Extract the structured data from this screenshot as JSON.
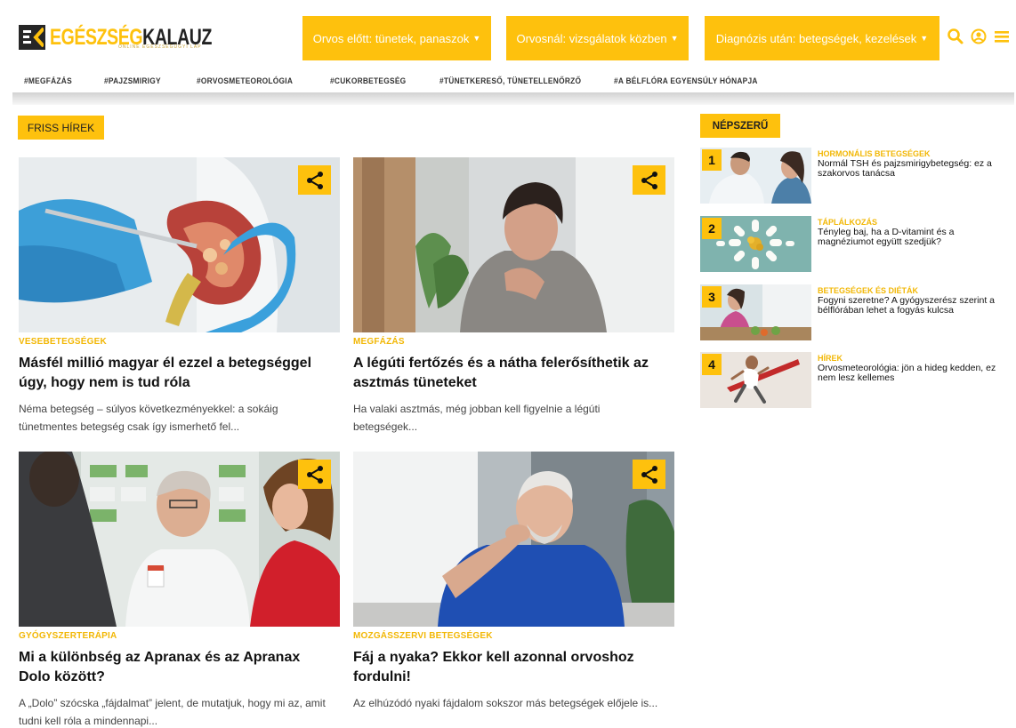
{
  "site": {
    "logo_part1": "EGÉSZSÉG",
    "logo_part2": "KALAUZ",
    "logo_tagline": "ONLINE EGÉSZSÉGÜGYI LAP",
    "brand_color": "#fec10d"
  },
  "nav": [
    {
      "label": "Orvos előtt: tünetek, panaszok"
    },
    {
      "label": "Orvosnál: vizsgálatok közben"
    },
    {
      "label": "Diagnózis után: betegségek, kezelések"
    }
  ],
  "tools": {
    "search_icon": "search-icon",
    "user_icon": "user-icon",
    "menu_icon": "hamburger-icon"
  },
  "tags": [
    "#MEGFÁZÁS",
    "#PAJZSMIRIGY",
    "#ORVOSMETEOROLÓGIA",
    "#CUKORBETEGSÉG",
    "#TÜNETKERESŐ, TÜNETELLENŐRZŐ",
    "#A BÉLFLÓRA EGYENSÚLY HÓNAPJA"
  ],
  "sections": {
    "news_label": "FRISS HÍREK",
    "popular_label": "NÉPSZERŰ"
  },
  "articles": [
    {
      "category": "VESEBETEGSÉGEK",
      "title": "Másfél millió magyar él ezzel a betegséggel úgy, hogy nem is tud róla",
      "excerpt": "Néma betegség – súlyos következményekkel: a sokáig tünetmentes betegség csak így ismerhető fel..."
    },
    {
      "category": "MEGFÁZÁS",
      "title": "A légúti fertőzés és a nátha felerősíthetik az asztmás tüneteket",
      "excerpt": "Ha valaki asztmás, még jobban kell figyelnie a légúti betegségek..."
    },
    {
      "category": "GYÓGYSZERTERÁPIA",
      "title": "Mi a különbség az Apranax és az Apranax Dolo között?",
      "excerpt": "A „Dolo” szócska „fájdalmat” jelent, de mutatjuk, hogy mi az, amit tudni kell róla a mindennapi..."
    },
    {
      "category": "MOZGÁSSZERVI BETEGSÉGEK",
      "title": "Fáj a nyaka? Ekkor kell azonnal orvoshoz fordulni!",
      "excerpt": "Az elhúzódó nyaki fájdalom sokszor más betegségek előjele is..."
    }
  ],
  "popular": [
    {
      "rank": "1",
      "category": "HORMONÁLIS BETEGSÉGEK",
      "title": "Normál TSH és pajzsmirigybetegség: ez a szakorvos tanácsa"
    },
    {
      "rank": "2",
      "category": "TÁPLÁLKOZÁS",
      "title": "Tényleg baj, ha a D-vitamint és a magnéziumot együtt szedjük?"
    },
    {
      "rank": "3",
      "category": "BETEGSÉGEK ÉS DIÉTÁK",
      "title": "Fogyni szeretne? A gyógyszerész szerint a bélflórában lehet a fogyás kulcsa"
    },
    {
      "rank": "4",
      "category": "HÍREK",
      "title": "Orvosmeteorológia: jön a hideg kedden, ez nem lesz kellemes"
    }
  ]
}
